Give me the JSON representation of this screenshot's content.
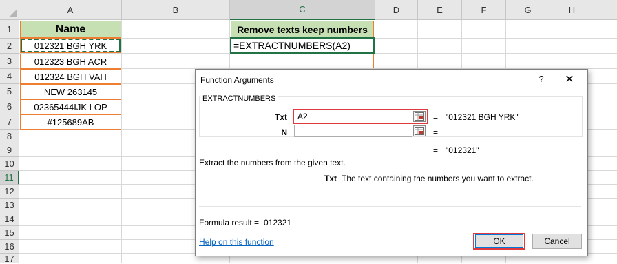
{
  "spreadsheet": {
    "columns": [
      "A",
      "B",
      "C",
      "D",
      "E",
      "F",
      "G",
      "H"
    ],
    "rows": [
      "1",
      "2",
      "3",
      "4",
      "5",
      "6",
      "7",
      "8",
      "9",
      "10",
      "11",
      "12",
      "13",
      "14",
      "15",
      "16",
      "17"
    ],
    "selected_column": "C",
    "selected_row": "11",
    "cells": {
      "A1": "Name",
      "A2": "012321 BGH YRK",
      "A3": "012323 BGH ACR",
      "A4": "012324 BGH VAH",
      "A5": "NEW 263145",
      "A6": "02365444IJK LOP",
      "A7": "#125689AB",
      "C1": "Remove texts keep numbers",
      "C2": "=EXTRACTNUMBERS(A2)"
    },
    "colors": {
      "header_fill": "#c6e0b4",
      "border_orange": "#ed7d31",
      "selection_green": "#217346",
      "highlight_red": "#e03a3e"
    }
  },
  "dialog": {
    "title": "Function Arguments",
    "help_glyph": "?",
    "close_glyph": "✕",
    "function_name": "EXTRACTNUMBERS",
    "args": [
      {
        "label": "Txt",
        "value": "A2",
        "result": "\"012321 BGH YRK\""
      },
      {
        "label": "N",
        "value": "",
        "result": ""
      }
    ],
    "equals": "=",
    "function_result": "\"012321\"",
    "description": "Extract the numbers from the given text.",
    "arg_help_name": "Txt",
    "arg_help_text": "The text containing the numbers you want to extract.",
    "formula_result_label": "Formula result =",
    "formula_result_value": "012321",
    "help_link": "Help on this function",
    "ok_label": "OK",
    "cancel_label": "Cancel"
  }
}
